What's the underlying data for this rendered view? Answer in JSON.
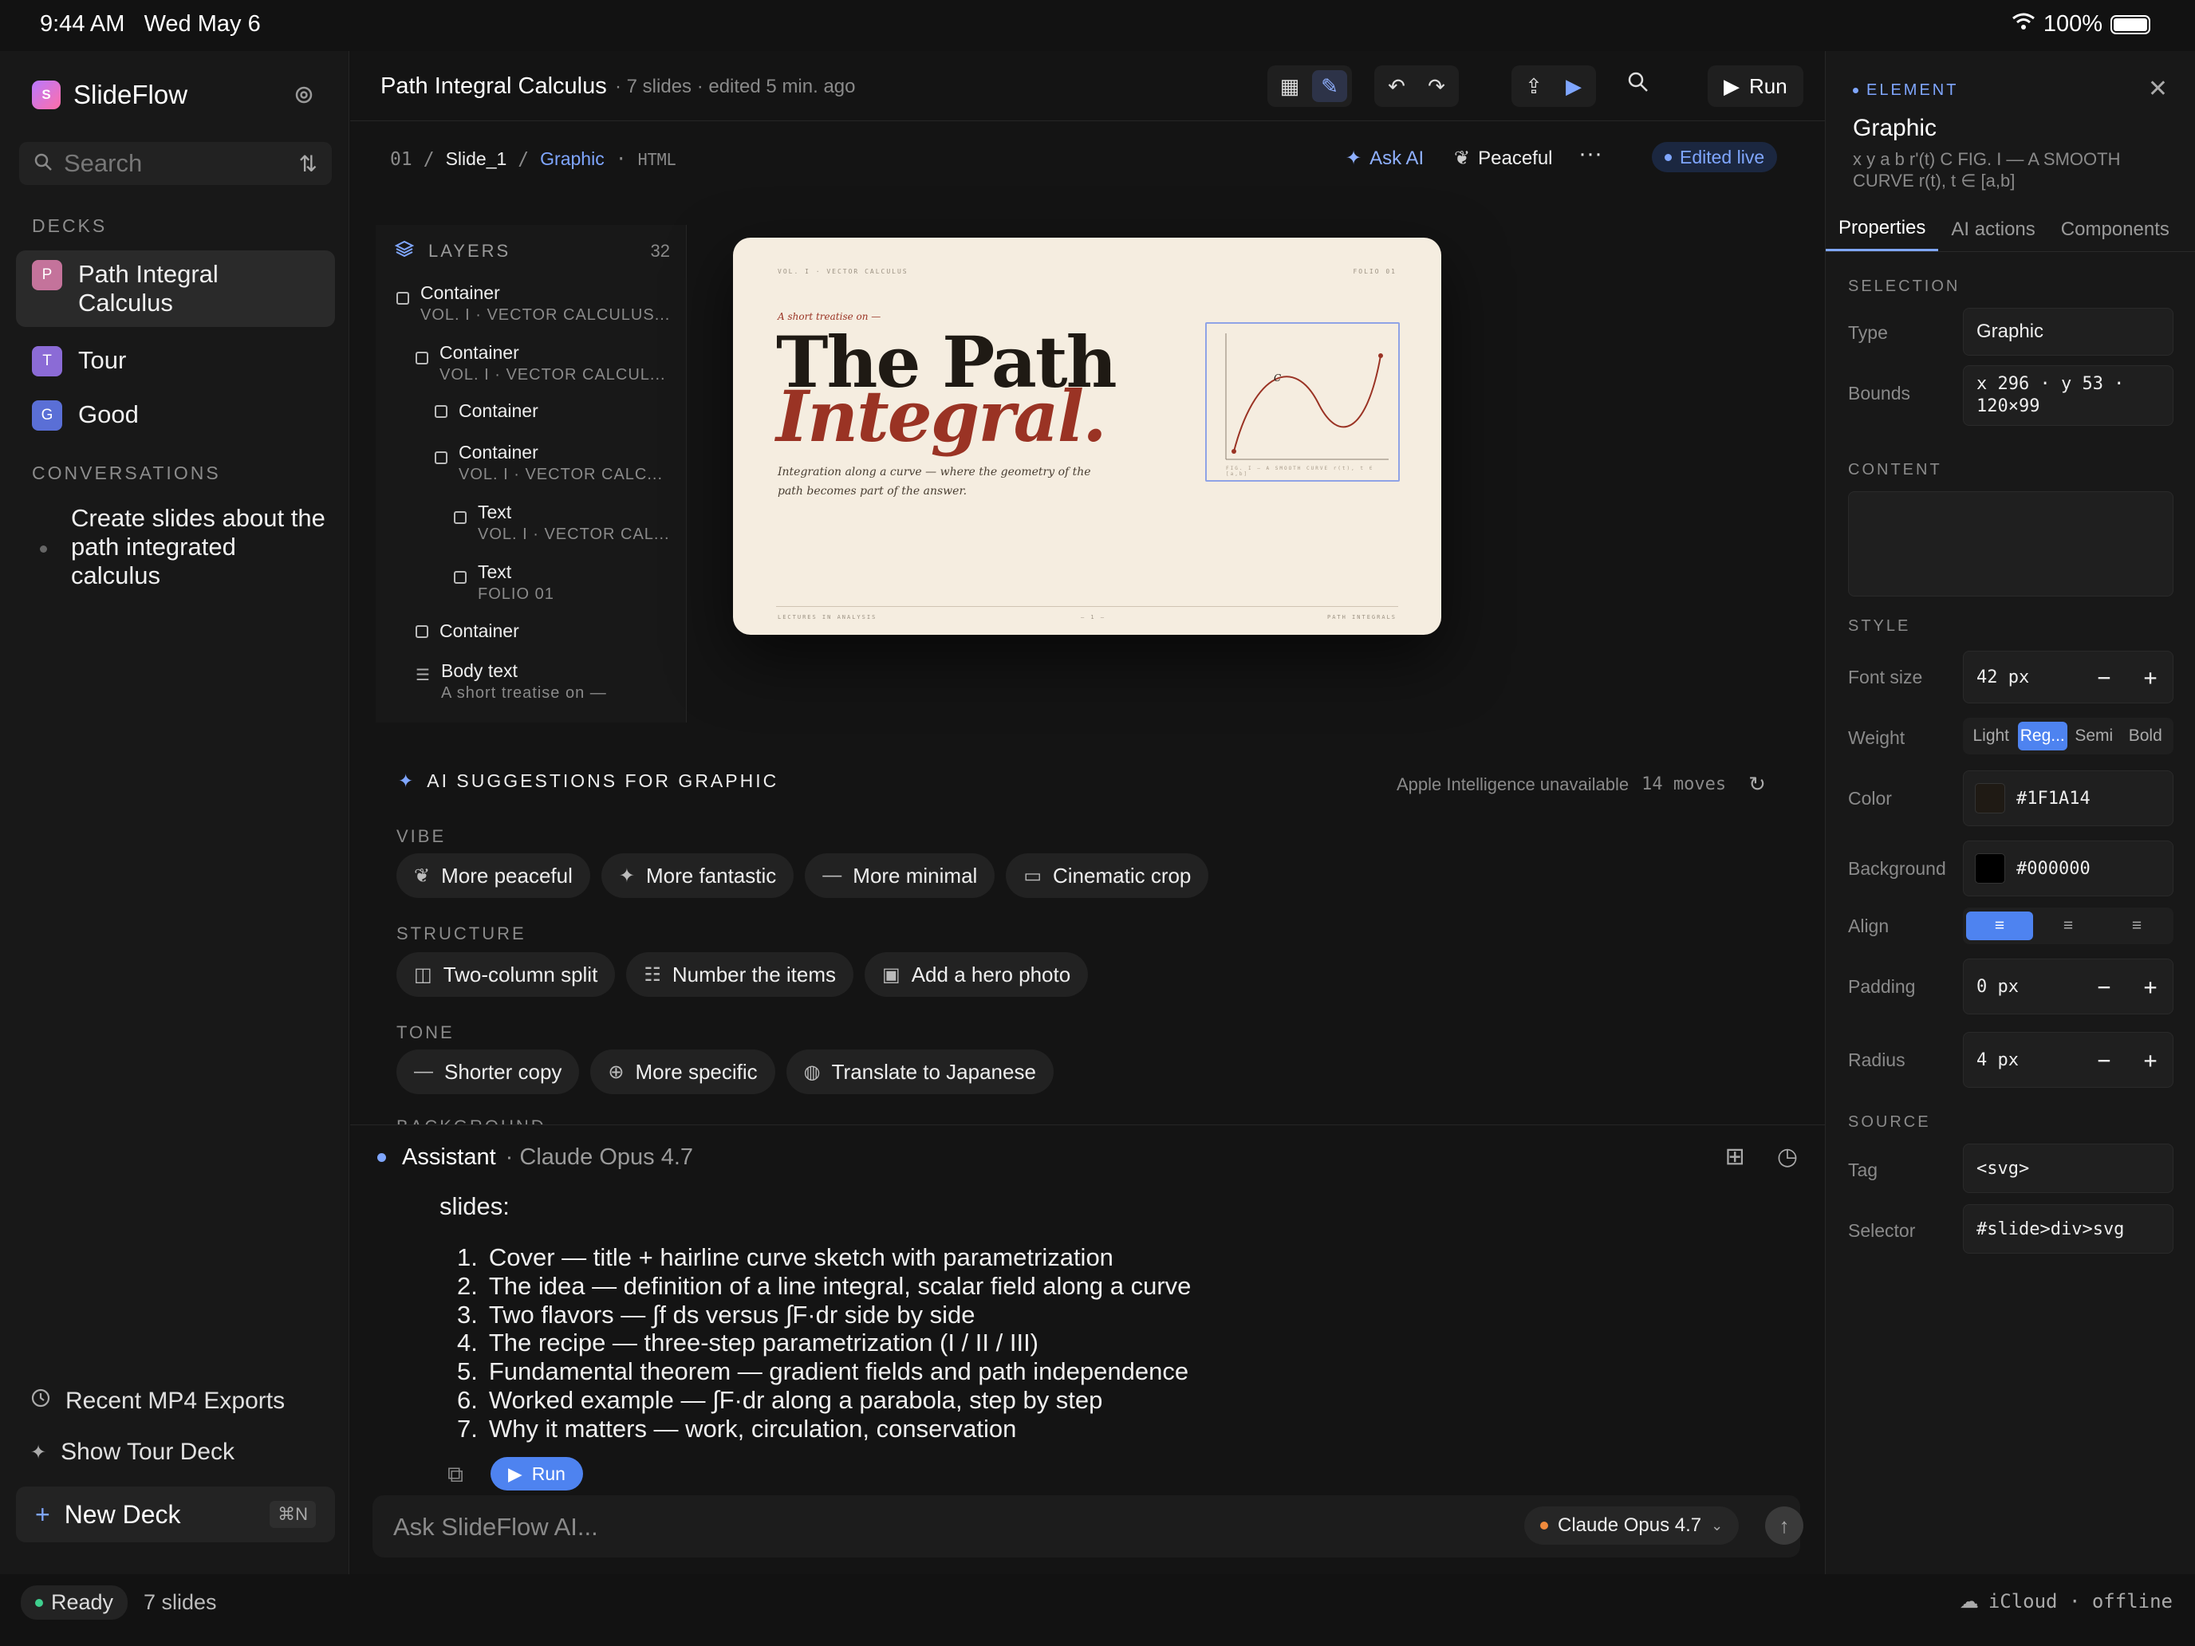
{
  "status": {
    "time": "9:44 AM",
    "date": "Wed May 6",
    "battery": "100%"
  },
  "sidebar": {
    "app_name": "SlideFlow",
    "search_placeholder": "Search",
    "decks_label": "DECKS",
    "decks": [
      {
        "initial": "P",
        "name": "Path Integral Calculus",
        "color": "#c4739b"
      },
      {
        "initial": "T",
        "name": "Tour",
        "color": "#8b6bd6"
      },
      {
        "initial": "G",
        "name": "Good",
        "color": "#5a6fd6"
      }
    ],
    "conversations_label": "CONVERSATIONS",
    "conversations": [
      "Create slides about the path integrated calculus"
    ],
    "recent_exports": "Recent MP4 Exports",
    "show_tour": "Show Tour Deck",
    "new_deck": "New Deck",
    "new_deck_shortcut": "⌘N"
  },
  "footer": {
    "ready": "Ready",
    "slides": "7 slides",
    "sync": "iCloud · offline"
  },
  "doc": {
    "title": "Path Integral Calculus",
    "meta": "· 7 slides · edited 5 min. ago",
    "run": "Run"
  },
  "breadcrumb": {
    "index": "01",
    "slide": "Slide_1",
    "element": "Graphic",
    "kind": "HTML"
  },
  "actions": {
    "ask_ai": "Ask AI",
    "style": "Peaceful",
    "more": "···",
    "edited": "Edited live"
  },
  "layers": {
    "title": "LAYERS",
    "count": "32",
    "items": [
      {
        "name": "Container",
        "sub": "VOL. I · VECTOR CALCULUS..."
      },
      {
        "name": "Container",
        "sub": "VOL. I · VECTOR CALCUL..."
      },
      {
        "name": "Container",
        "sub": ""
      },
      {
        "name": "Container",
        "sub": "VOL. I · VECTOR CALC..."
      },
      {
        "name": "Text",
        "sub": "VOL. I · VECTOR CAL..."
      },
      {
        "name": "Text",
        "sub": "FOLIO 01"
      },
      {
        "name": "Container",
        "sub": ""
      },
      {
        "name": "Body text",
        "sub": "A short treatise on —"
      }
    ]
  },
  "slide": {
    "vol": "VOL. I · VECTOR CALCULUS",
    "folio": "FOLIO 01",
    "kicker": "A short treatise on —",
    "title_line1": "The Path",
    "title_line2": "Integral.",
    "lede": "Integration along a curve — where the geometry of the path becomes part of the answer.",
    "fig_caption": "FIG. I — A SMOOTH CURVE r(t), t ∈ [a,b]",
    "footer_left": "LECTURES IN ANALYSIS",
    "footer_mid": "— 1 —",
    "footer_right": "PATH INTEGRALS",
    "curve_color": "#9a3324",
    "paper_color": "#f5ede0"
  },
  "suggestions": {
    "title": "AI SUGGESTIONS FOR GRAPHIC",
    "status": "Apple Intelligence unavailable",
    "moves": "14 moves",
    "vibe_label": "VIBE",
    "vibe": [
      {
        "icon": "leaf-icon",
        "label": "More peaceful"
      },
      {
        "icon": "sparkle-icon",
        "label": "More fantastic"
      },
      {
        "icon": "minus-icon",
        "label": "More minimal"
      },
      {
        "icon": "film-icon",
        "label": "Cinematic crop"
      }
    ],
    "structure_label": "STRUCTURE",
    "structure": [
      {
        "icon": "columns-icon",
        "label": "Two-column split"
      },
      {
        "icon": "list-numbered-icon",
        "label": "Number the items"
      },
      {
        "icon": "photo-icon",
        "label": "Add a hero photo"
      }
    ],
    "tone_label": "TONE",
    "tone": [
      {
        "icon": "minus-icon",
        "label": "Shorter copy"
      },
      {
        "icon": "target-icon",
        "label": "More specific"
      },
      {
        "icon": "globe-icon",
        "label": "Translate to Japanese"
      }
    ],
    "background_label": "BACKGROUND"
  },
  "assistant": {
    "name": "Assistant",
    "model": "· Claude Opus 4.7",
    "intro": "slides:",
    "items": [
      "Cover — title + hairline curve sketch with parametrization",
      "The idea — definition of a line integral, scalar field along a curve",
      "Two flavors — ∫f ds versus ∫F·dr side by side",
      "The recipe — three-step parametrization (I / II / III)",
      "Fundamental theorem — gradient fields and path independence",
      "Worked example — ∫F·dr along a parabola, step by step",
      "Why it matters — work, circulation, conservation"
    ],
    "run": "Run",
    "input_placeholder": "Ask SlideFlow AI...",
    "model_pill": "Claude Opus 4.7"
  },
  "inspector": {
    "tag": "ELEMENT",
    "name": "Graphic",
    "desc": "x y a b r'(t) C FIG. I — A SMOOTH CURVE r(t), t ∈ [a,b]",
    "tabs": [
      "Properties",
      "AI actions",
      "Components"
    ],
    "selection_label": "SELECTION",
    "type_label": "Type",
    "type_value": "Graphic",
    "bounds_label": "Bounds",
    "bounds_value": "x 296 · y 53 · 120×99",
    "content_label": "CONTENT",
    "style_label": "STYLE",
    "font_size_label": "Font size",
    "font_size_value": "42 px",
    "weight_label": "Weight",
    "weights": [
      "Light",
      "Reg...",
      "Semi",
      "Bold"
    ],
    "color_label": "Color",
    "color_value": "#1F1A14",
    "background_label": "Background",
    "background_value": "#000000",
    "align_label": "Align",
    "padding_label": "Padding",
    "padding_value": "0 px",
    "radius_label": "Radius",
    "radius_value": "4 px",
    "source_label": "SOURCE",
    "tag_label": "Tag",
    "tag_value": "<svg>",
    "selector_label": "Selector",
    "selector_value": "#slide>div>svg"
  }
}
